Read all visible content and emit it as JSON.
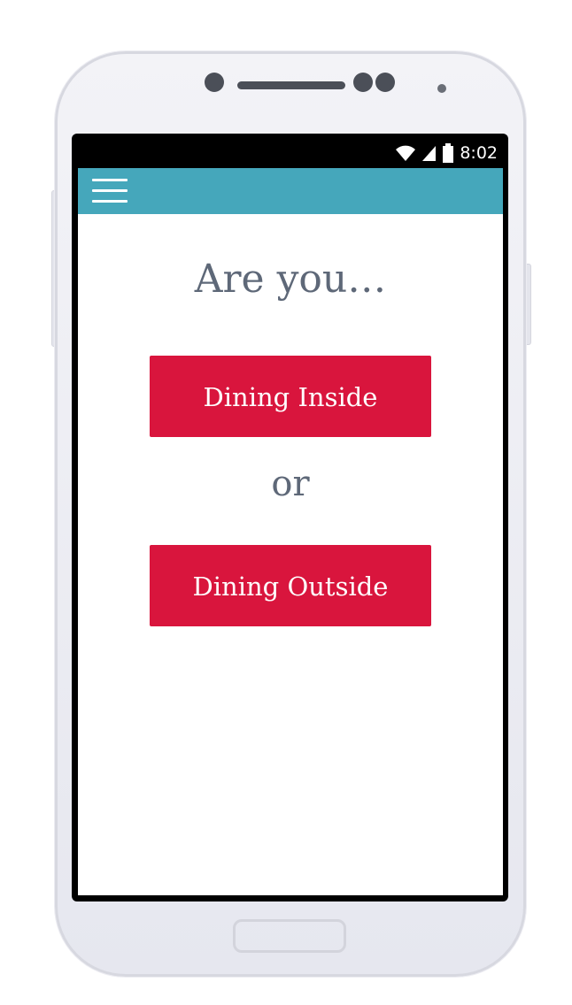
{
  "device": {
    "icons": [
      "camera-icon",
      "speaker-icon",
      "sensor-icon",
      "home-button"
    ]
  },
  "status_bar": {
    "time": "8:02",
    "icons": [
      "wifi-icon",
      "signal-icon",
      "battery-icon"
    ]
  },
  "app_bar": {
    "menu_icon": "hamburger-menu-icon",
    "color": "#45a7bb"
  },
  "main": {
    "heading": "Are you…",
    "buttons": {
      "inside_label": "Dining Inside",
      "outside_label": "Dining Outside"
    },
    "separator": "or",
    "button_color": "#d9153d",
    "text_color": "#5e6878"
  }
}
